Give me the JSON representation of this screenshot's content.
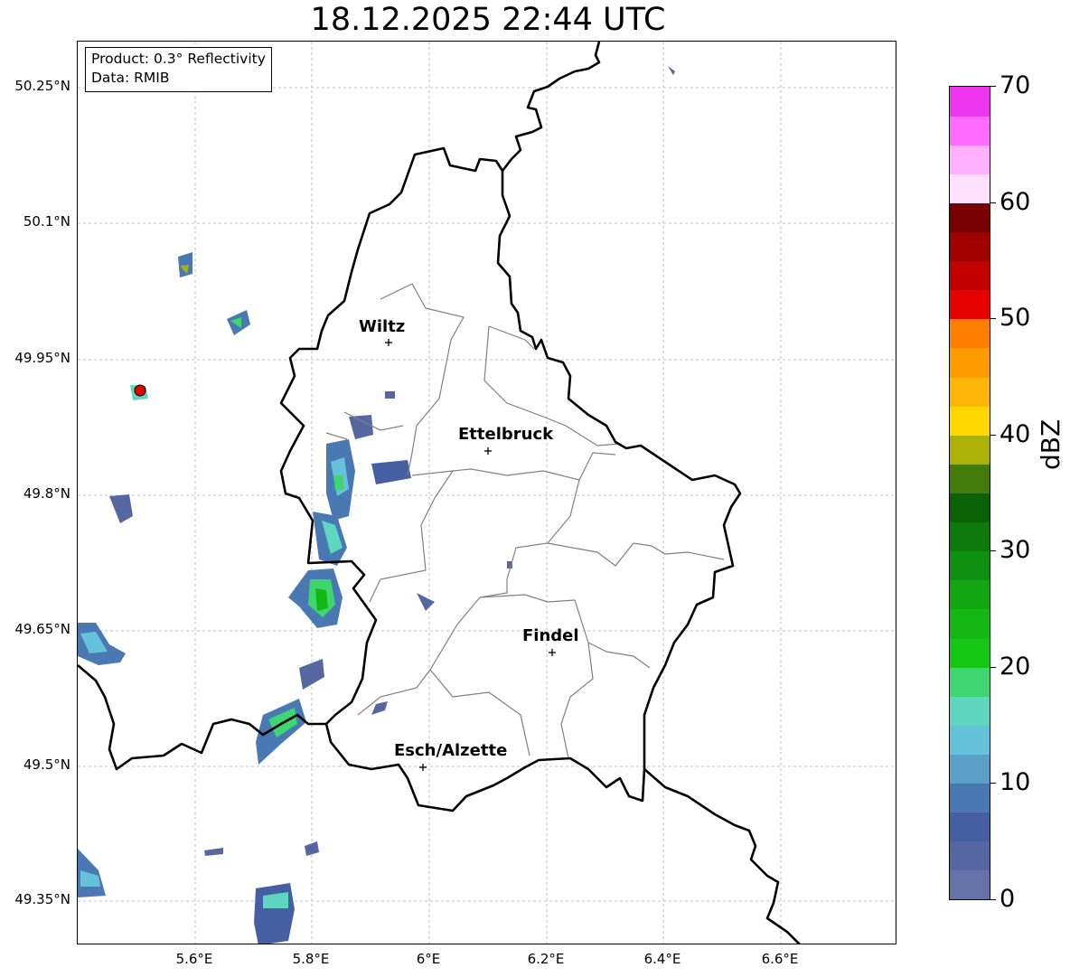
{
  "title": "18.12.2025 22:44 UTC",
  "info": {
    "product": "Product: 0.3° Reflectivity",
    "data": "Data: RMIB"
  },
  "axes": {
    "lat_labels": [
      "50.25°N",
      "50.1°N",
      "49.95°N",
      "49.8°N",
      "49.65°N",
      "49.5°N",
      "49.35°N"
    ],
    "lon_labels": [
      "5.6°E",
      "5.8°E",
      "6°E",
      "6.2°E",
      "6.4°E",
      "6.6°E"
    ]
  },
  "cities": [
    {
      "name": "Wiltz"
    },
    {
      "name": "Ettelbruck"
    },
    {
      "name": "Findel"
    },
    {
      "name": "Esch/Alzette"
    }
  ],
  "colorbar": {
    "unit": "dBZ",
    "ticks": [
      "0",
      "10",
      "20",
      "30",
      "40",
      "50",
      "60",
      "70"
    ],
    "colors": [
      "#6474a8",
      "#5566a0",
      "#455fa2",
      "#4a78b3",
      "#5a9fc6",
      "#66c2da",
      "#5fd6c0",
      "#3dd670",
      "#14c814",
      "#14b814",
      "#12a612",
      "#10900f",
      "#0e7a0e",
      "#0a6108",
      "#437a0a",
      "#adb006",
      "#ffd800",
      "#fdb507",
      "#fe9b00",
      "#ff7f00",
      "#e60000",
      "#c20000",
      "#a00000",
      "#780000",
      "#ffe0ff",
      "#ffb0ff",
      "#ff6cff",
      "#ee36ee"
    ]
  },
  "colors": {
    "border": "#000000",
    "district": "#808080",
    "grid": "#b0b0b0"
  }
}
